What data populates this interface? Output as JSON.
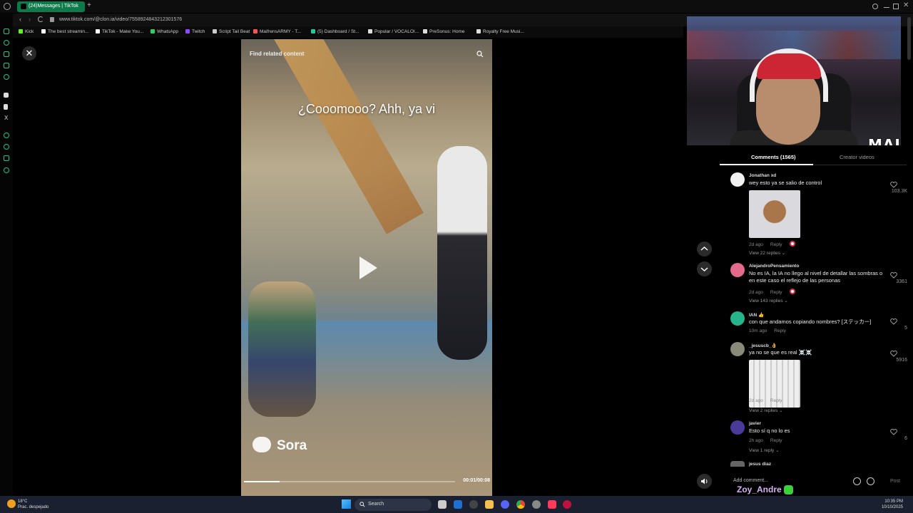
{
  "browser": {
    "tab_title": "(24)Messages | TikTok",
    "new_tab": "+",
    "url": "www.tiktok.com/@clon.ia/video/7558924843212301576",
    "bookmarks": [
      {
        "label": "Kick",
        "color": "#53fc18"
      },
      {
        "label": "The best streamin...",
        "color": "#ffffff"
      },
      {
        "label": "TikTok - Make You...",
        "color": "#ffffff"
      },
      {
        "label": "WhatsApp",
        "color": "#25d366"
      },
      {
        "label": "Twitch",
        "color": "#9146ff"
      },
      {
        "label": "Script Tail Beat",
        "color": "#cccccc"
      },
      {
        "label": "MaifrensARMY - T...",
        "color": "#ff5050"
      },
      {
        "label": "(5) Dashboard / St...",
        "color": "#20c997"
      },
      {
        "label": "Popular / VOCALOI...",
        "color": "#dddddd"
      },
      {
        "label": "PreSonus: Home",
        "color": "#dddddd"
      },
      {
        "label": "Royalty Free Musi...",
        "color": "#dddddd"
      }
    ]
  },
  "video": {
    "find_related": "Find related content",
    "caption": "¿Cooomooo? Ahh, ya vi",
    "watermark": "Sora",
    "time": "00:01/00:08",
    "progress": 0.17
  },
  "overlay": {
    "streamer_tag": "MAI"
  },
  "panel": {
    "tab_comments": "Comments (1565)",
    "tab_creator": "Creator videos",
    "comments": [
      {
        "user": "Jonathan xd",
        "text": "wey esto ya se salio de control",
        "time": "2d ago",
        "reply": "Reply",
        "likes": "103.3K",
        "view": "View 22 replies",
        "avatar": "#f2f2f2"
      },
      {
        "user": "AlejandroPensamiento",
        "text": "No es IA, la IA no llego al nivel de detallar las sombras o en este caso el reflejo de las personas",
        "time": "2d ago",
        "reply": "Reply",
        "likes": "3361",
        "view": "View 143 replies",
        "avatar": "#e36a8a"
      },
      {
        "user": "IAN 👍",
        "text": "con que andamos copiando nombres? [ステッカー]",
        "time": "10m ago",
        "reply": "Reply",
        "likes": "5",
        "view": "",
        "avatar": "#26b58a"
      },
      {
        "user": "_jesuscb_👌",
        "text": "ya no se que es real ☠️☠️",
        "time": "2d ago",
        "reply": "Reply",
        "likes": "5916",
        "view": "View 2 replies",
        "avatar": "#8a8a7a"
      },
      {
        "user": "javier",
        "text": "Esto sí q no lo es",
        "time": "2h ago",
        "reply": "Reply",
        "likes": "6",
        "view": "View 1 reply",
        "avatar": "#4a3a9a"
      },
      {
        "user": "jesus diaz",
        "text": "",
        "time": "",
        "reply": "",
        "likes": "",
        "view": "",
        "avatar": "#666666"
      }
    ],
    "add_comment": "Add comment...",
    "post": "Post",
    "overlay_user": "Zoy_Andre"
  },
  "taskbar": {
    "temp": "18°C",
    "weather": "Prac. despejado",
    "search": "Search",
    "time": "10:35 PM",
    "date": "10/10/2025"
  }
}
